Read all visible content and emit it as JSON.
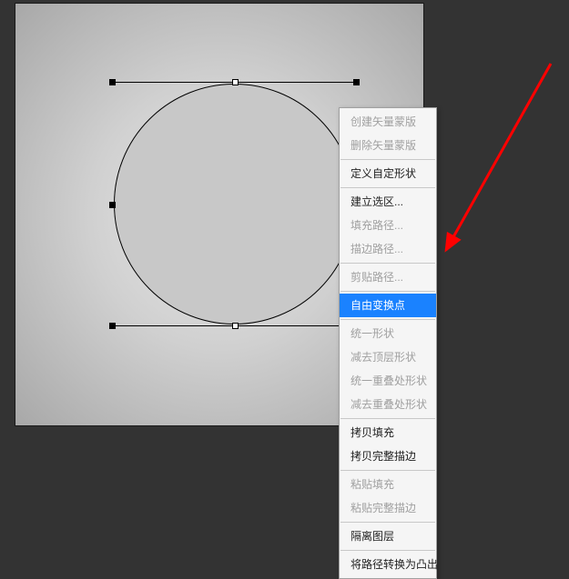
{
  "canvas": {
    "shape": "circle"
  },
  "context_menu": {
    "groups": [
      [
        {
          "label": "创建矢量蒙版",
          "disabled": true,
          "highlighted": false
        },
        {
          "label": "删除矢量蒙版",
          "disabled": true,
          "highlighted": false
        }
      ],
      [
        {
          "label": "定义自定形状",
          "disabled": false,
          "highlighted": false
        }
      ],
      [
        {
          "label": "建立选区...",
          "disabled": false,
          "highlighted": false
        },
        {
          "label": "填充路径...",
          "disabled": true,
          "highlighted": false
        },
        {
          "label": "描边路径...",
          "disabled": true,
          "highlighted": false
        }
      ],
      [
        {
          "label": "剪贴路径...",
          "disabled": true,
          "highlighted": false
        }
      ],
      [
        {
          "label": "自由变换点",
          "disabled": false,
          "highlighted": true
        }
      ],
      [
        {
          "label": "统一形状",
          "disabled": true,
          "highlighted": false
        },
        {
          "label": "减去顶层形状",
          "disabled": true,
          "highlighted": false
        },
        {
          "label": "统一重叠处形状",
          "disabled": true,
          "highlighted": false
        },
        {
          "label": "减去重叠处形状",
          "disabled": true,
          "highlighted": false
        }
      ],
      [
        {
          "label": "拷贝填充",
          "disabled": false,
          "highlighted": false
        },
        {
          "label": "拷贝完整描边",
          "disabled": false,
          "highlighted": false
        }
      ],
      [
        {
          "label": "粘贴填充",
          "disabled": true,
          "highlighted": false
        },
        {
          "label": "粘贴完整描边",
          "disabled": true,
          "highlighted": false
        }
      ],
      [
        {
          "label": "隔离图层",
          "disabled": false,
          "highlighted": false
        }
      ],
      [
        {
          "label": "将路径转换为凸出",
          "disabled": false,
          "highlighted": false
        }
      ]
    ]
  },
  "annotation": {
    "arrow_color": "#ff0000"
  }
}
